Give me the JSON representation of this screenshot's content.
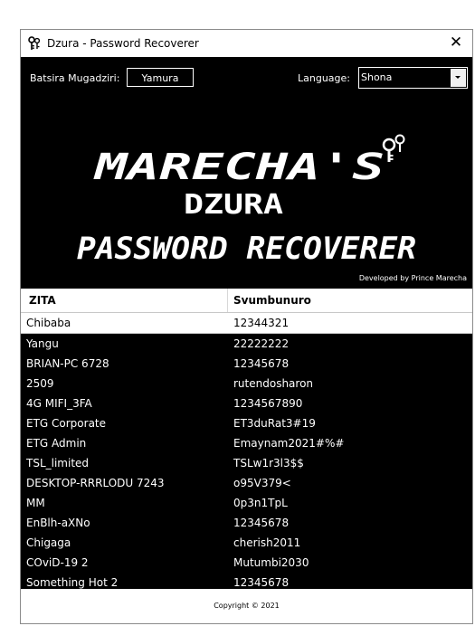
{
  "window": {
    "title": "Dzura - Password Recoverer",
    "close_icon": "close-icon",
    "app_icon": "keys-icon"
  },
  "toolbar": {
    "caller_label": "Batsira Mugadziri:",
    "name_value": "Yamura",
    "language_label": "Language:",
    "language_value": "Shona"
  },
  "logo": {
    "line1": "MARECHA'S",
    "line2": "DZURA",
    "line3": "PASSWORD RECOVERER",
    "accent": "#ffffff"
  },
  "credit": "Developed by Prince Marecha",
  "table": {
    "headers": [
      "ZITA",
      "Svumbunuro"
    ],
    "rows": [
      [
        "Chibaba",
        "12344321"
      ],
      [
        "Yangu",
        "22222222"
      ],
      [
        "BRIAN-PC 6728",
        "12345678"
      ],
      [
        "2509",
        "rutendosharon"
      ],
      [
        "4G MIFI_3FA",
        "1234567890"
      ],
      [
        "ETG Corporate",
        "ET3duRat3#19"
      ],
      [
        "ETG Admin",
        "Emaynam2021#%#"
      ],
      [
        "TSL_limited",
        "TSLw1r3l3$$"
      ],
      [
        "DESKTOP-RRRLODU 7243",
        "o95V379<"
      ],
      [
        "MM",
        "0p3n1TpL"
      ],
      [
        "EnBlh-aXNo",
        "12345678"
      ],
      [
        "Chigaga",
        "cherish2011"
      ],
      [
        "COviD-19 2",
        "Mutumbi2030"
      ],
      [
        "Something Hot 2",
        "12345678"
      ]
    ]
  },
  "footer": {
    "copyright": "Copyright © 2021"
  }
}
